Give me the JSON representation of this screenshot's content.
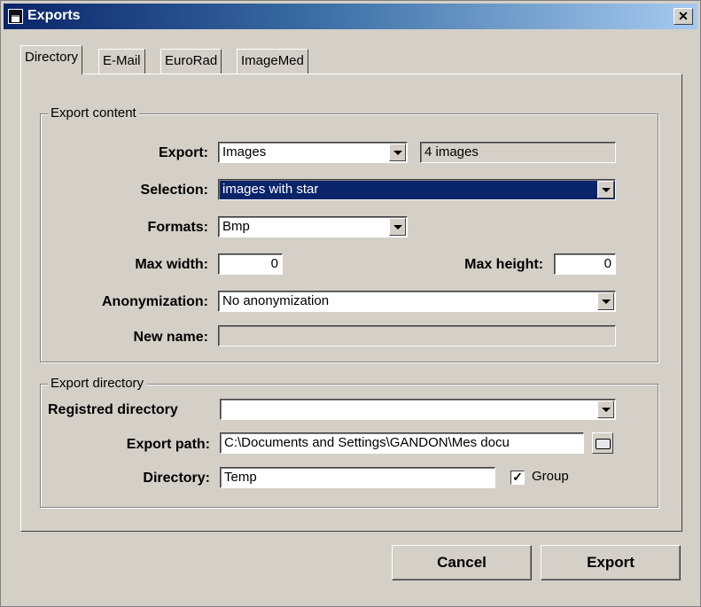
{
  "window": {
    "title": "Exports",
    "close_glyph": "✕"
  },
  "tabs": [
    "Directory",
    "E-Mail",
    "EuroRad",
    "ImageMed"
  ],
  "export_content": {
    "legend": "Export content",
    "export_label": "Export:",
    "export_value": "Images",
    "count_value": "4 images",
    "selection_label": "Selection:",
    "selection_value": "images with star",
    "formats_label": "Formats:",
    "formats_value": "Bmp",
    "max_width_label": "Max width:",
    "max_width_value": "0",
    "max_height_label": "Max height:",
    "max_height_value": "0",
    "anonymization_label": "Anonymization:",
    "anonymization_value": "No anonymization",
    "new_name_label": "New name:",
    "new_name_value": ""
  },
  "export_directory": {
    "legend": "Export directory",
    "registred_label": "Registred directory",
    "registred_value": "",
    "path_label": "Export path:",
    "path_value": "C:\\Documents and Settings\\GANDON\\Mes docu",
    "directory_label": "Directory:",
    "directory_value": "Temp",
    "group_label": "Group",
    "group_checked": true
  },
  "buttons": {
    "cancel": "Cancel",
    "export": "Export"
  }
}
